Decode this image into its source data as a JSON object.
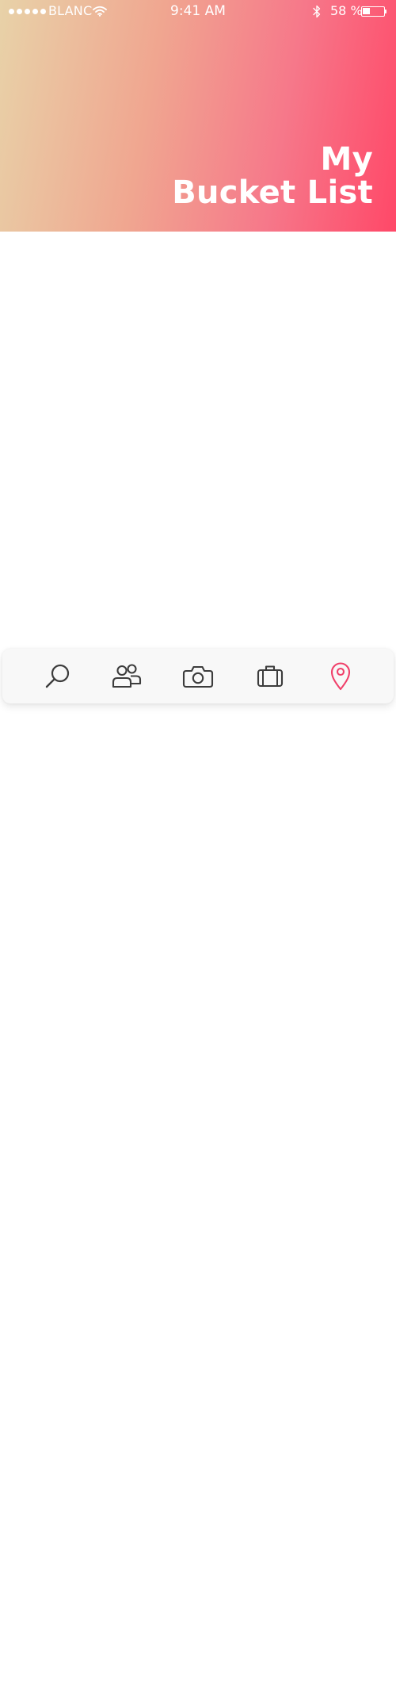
{
  "status_bar": {
    "carrier": "BLANC",
    "time": "9:41 AM",
    "battery_percent": "58 %",
    "battery_level": 0.58,
    "signal_bars": 5,
    "icons": [
      "signal-dots",
      "wifi-icon",
      "bluetooth-icon",
      "battery-icon"
    ]
  },
  "header": {
    "title_line1": "My",
    "title_line2": "Bucket List",
    "gradient_colors": [
      "#e8d2a8",
      "#f0a690",
      "#f6788a",
      "#ff4868"
    ]
  },
  "tab_bar": {
    "tabs": [
      {
        "icon": "search-icon",
        "active": false
      },
      {
        "icon": "people-icon",
        "active": false
      },
      {
        "icon": "camera-icon",
        "active": false
      },
      {
        "icon": "briefcase-icon",
        "active": false
      },
      {
        "icon": "location-pin-icon",
        "active": true
      }
    ],
    "inactive_color": "#3c3c3c",
    "active_color": "#f0406a"
  }
}
